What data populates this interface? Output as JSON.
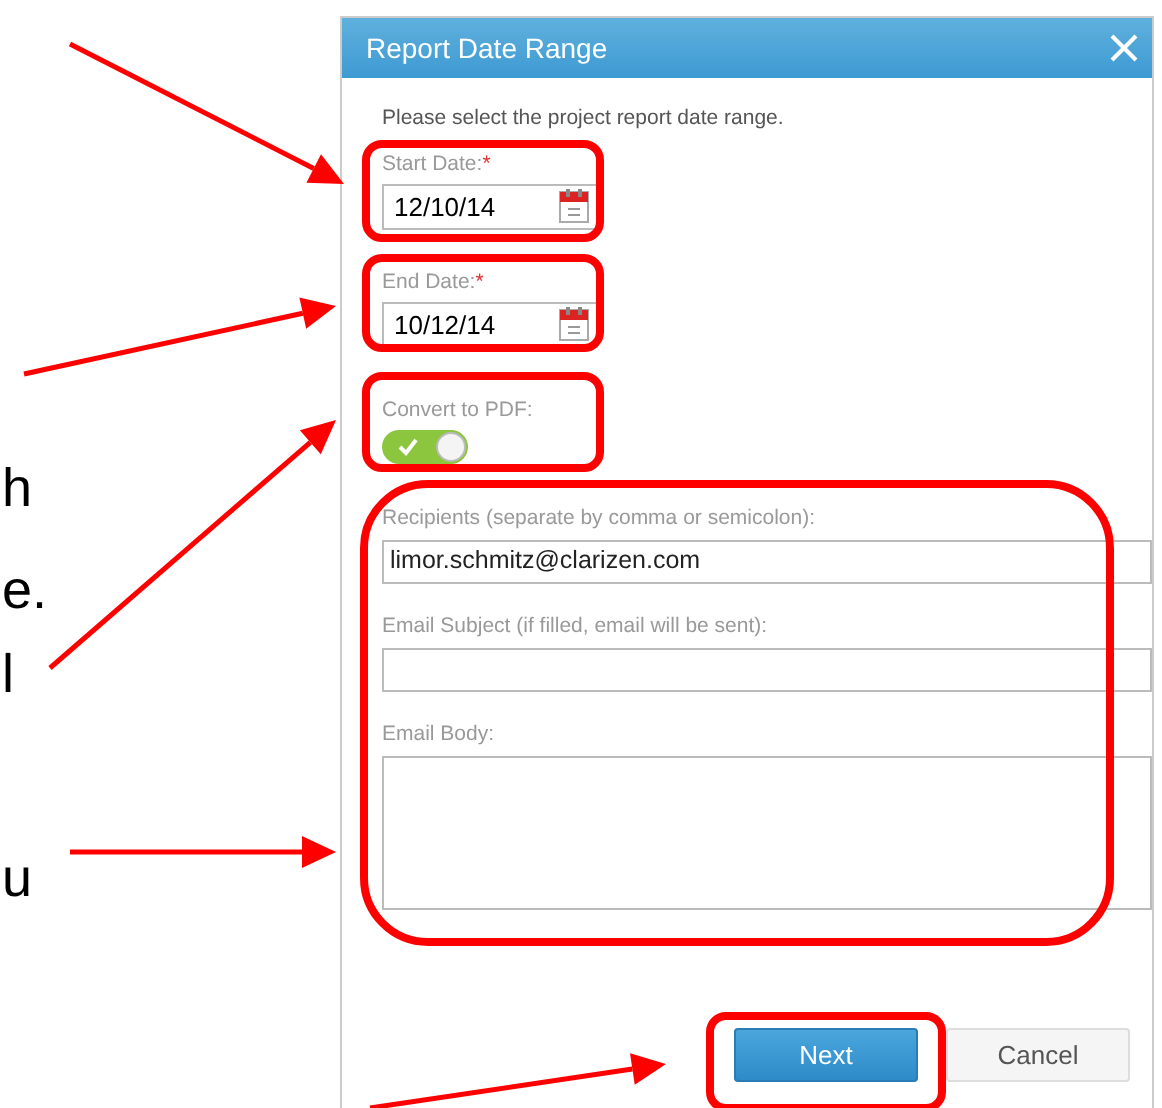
{
  "slide_text_fragments": [
    "h",
    "e.",
    "l",
    "u"
  ],
  "dialog": {
    "title": "Report Date Range",
    "instruction": "Please select the project report date range.",
    "fields": [
      {
        "kind": "date",
        "label": "Start Date:",
        "required_mark": "*",
        "value": "12/10/14"
      },
      {
        "kind": "date",
        "label": "End Date:",
        "required_mark": "*",
        "value": "10/12/14"
      },
      {
        "kind": "toggle",
        "label": "Convert to PDF:",
        "on": true
      },
      {
        "kind": "text",
        "label": "Recipients (separate by comma or semicolon):",
        "value": "limor.schmitz@clarizen.com"
      },
      {
        "kind": "text",
        "label": "Email Subject (if filled, email will be sent):"
      },
      {
        "kind": "textarea",
        "label": "Email Body:"
      }
    ],
    "buttons": [
      {
        "label": "Next",
        "primary": true
      },
      {
        "label": "Cancel",
        "primary": false
      }
    ]
  }
}
